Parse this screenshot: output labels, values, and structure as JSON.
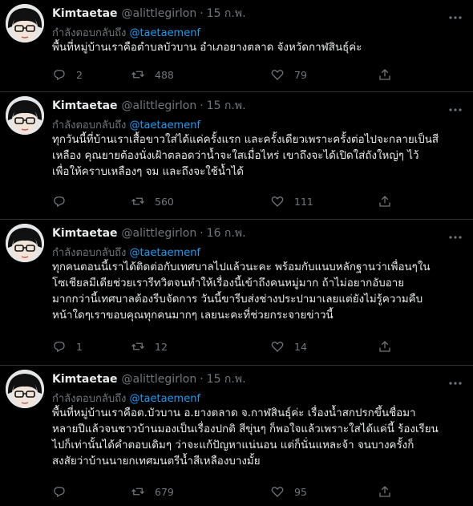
{
  "tweets": [
    {
      "name": "Kimtaetae",
      "handle": "@alittlegirlon",
      "time": "15 ก.พ.",
      "reply_prefix": "กำลังตอบกลับถึง",
      "reply_to": "@taetaemenf",
      "lines": [
        "พื้นที่หมู่บ้านเราคือตำบลบัวบาน อำเภอยางตลาด จังหวัดกาฬสินธุ์ค่ะ"
      ],
      "replies": "2",
      "retweets": "488",
      "likes": "79"
    },
    {
      "name": "Kimtaetae",
      "handle": "@alittlegirlon",
      "time": "15 ก.พ.",
      "reply_prefix": "กำลังตอบกลับถึง",
      "reply_to": "@taetaemenf",
      "lines": [
        "ทุกวันนี้ที่บ้านเราเสื้อขาวใส่ได้แค่ครั้งแรก และครั้งเดียวเพราะครั้งต่อไปจะกลายเป็นสี",
        "เหลือง คุณยายต้องนั่งเฝ้าตลอดว่าน้ำจะใสเมื่อไหร่ เขาถึงจะได้เปิดใส่ถังใหญ่ๆ ไว้",
        "เพื่อให้คราบเหลืองๆ จม และถึงจะใช้น้ำได้"
      ],
      "replies": "",
      "retweets": "560",
      "likes": "111"
    },
    {
      "name": "Kimtaetae",
      "handle": "@alittlegirlon",
      "time": "16 ก.พ.",
      "reply_prefix": "กำลังตอบกลับถึง",
      "reply_to": "@taetaemenf",
      "lines": [
        "ทุกคนตอนนี้เราได้ติดต่อกับเทศบาลไปแล้วนะคะ พร้อมกับแนบหลักฐานว่าเพื่อนๆใน",
        "โซเชียลมีเดียช่วยเรารีทวิตจนทำให้เรื่องนี้เข้าถึงคนหมู่มาก ถ้าไม่อยากอับอาย",
        "มากกว่านี้เทศบาลต้องรีบจัดการ วันนี้ขารีบส่งช่างประปามาเลยแต่ยังไม่รู้ความคืบ",
        "หน้าใดๆเราขอบคุณทุกคนมากๆ เลยนะคะที่ช่วยกระจายข่าวนี้"
      ],
      "replies": "1",
      "retweets": "12",
      "likes": "14"
    },
    {
      "name": "Kimtaetae",
      "handle": "@alittlegirlon",
      "time": "15 ก.พ.",
      "reply_prefix": "กำลังตอบกลับถึง",
      "reply_to": "@taetaemenf",
      "lines": [
        "พื้นที่หมู่บ้านเราคือต.บัวบาน อ.ยางตลาด จ.กาฬสินธุ์ค่ะ เรื่องน้ำสกปรกขึ้นชื่อมา",
        "หลายปีแล้วจนชาวบ้านมองเป็นเรื่องปกติ สีขุ่นๆ ก็พอใจแล้วเพราะใสได้แค่นี้ ร้องเรียน",
        "ไปก็เท่านั้นได้คำตอบเดิมๆ ว่าจะแก้ปัญหาแน่นอน แต่ก็นั่นแหละจ้า จนบางครั้งก็",
        "สงสัยว่าบ้านนายกเทศมนตรีน้ำสีเหลืองบางมั้ย"
      ],
      "replies": "",
      "retweets": "679",
      "likes": "95"
    }
  ],
  "icons": {
    "reply": "reply-icon",
    "retweet": "retweet-icon",
    "like": "heart-icon",
    "share": "share-icon",
    "more": "more-icon"
  }
}
